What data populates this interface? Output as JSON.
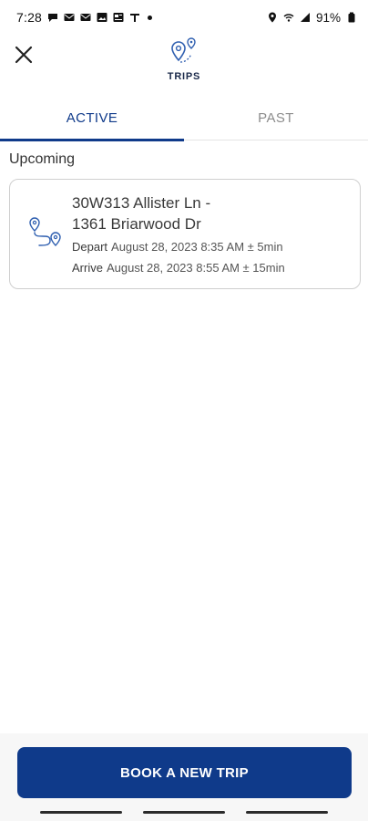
{
  "status_bar": {
    "time": "7:28",
    "battery": "91%",
    "icons": [
      "chat-icon",
      "mail-icon",
      "mail-icon",
      "image-icon",
      "news-icon",
      "flag-icon",
      "location-icon",
      "wifi-icon",
      "signal-icon",
      "battery-icon"
    ]
  },
  "header": {
    "title": "TRIPS",
    "close_icon": "close-icon",
    "logo_icon": "route-pins-icon"
  },
  "tabs": [
    {
      "label": "ACTIVE",
      "active": true
    },
    {
      "label": "PAST",
      "active": false
    }
  ],
  "upcoming": {
    "section_label": "Upcoming",
    "trips": [
      {
        "route_line1": "30W313 Allister Ln -",
        "route_line2": "1361 Briarwood Dr",
        "depart_label": "Depart",
        "depart_value": "August 28, 2023 8:35 AM ± 5min",
        "arrive_label": "Arrive",
        "arrive_value": "August 28, 2023 8:55 AM ± 15min"
      }
    ]
  },
  "actions": {
    "book_button_label": "BOOK A NEW TRIP"
  },
  "colors": {
    "primary": "#0f3a8a",
    "inactive_tab": "#8c8c8c",
    "card_border": "#cfcfcf"
  }
}
